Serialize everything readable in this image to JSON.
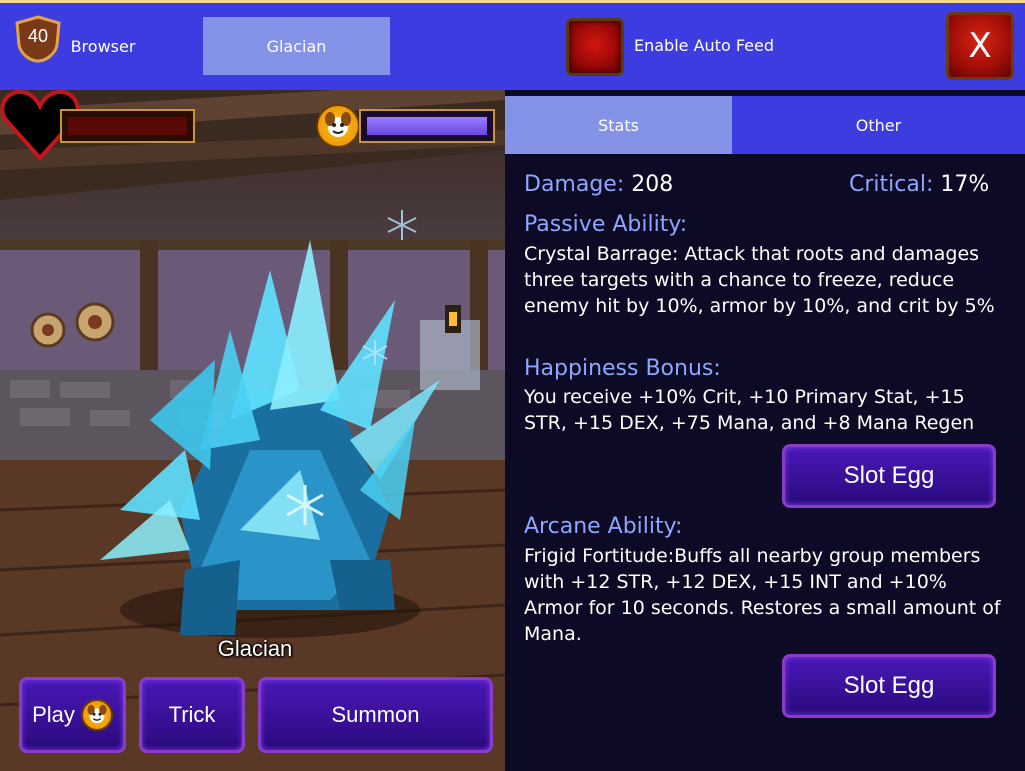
{
  "tabs": {
    "browser": "Browser",
    "pet": "Glacian"
  },
  "auto_feed": {
    "label": "Enable Auto Feed"
  },
  "close": {
    "label": "X"
  },
  "pet": {
    "level": "40",
    "name": "Glacian",
    "xp_fill": 0,
    "happiness_fill": 1.0
  },
  "actions": {
    "play": "Play",
    "trick": "Trick",
    "summon": "Summon"
  },
  "subtabs": {
    "stats": "Stats",
    "other": "Other"
  },
  "stats": {
    "damage_label": "Damage:",
    "damage_value": "208",
    "critical_label": "Critical:",
    "critical_value": "17%"
  },
  "passive": {
    "title": "Passive Ability:",
    "text": "Crystal Barrage: Attack that roots and damages three targets with a chance to freeze, reduce enemy hit by 10%, armor by 10%, and crit by 5%"
  },
  "happiness": {
    "title": "Happiness Bonus:",
    "text": "You receive +10% Crit, +10 Primary Stat, +15 STR, +15 DEX, +75 Mana, and +8 Mana Regen",
    "slot_label": "Slot Egg"
  },
  "arcane": {
    "title": "Arcane Ability:",
    "text": "Frigid Fortitude:Buffs all nearby group members with +12 STR, +12 DEX, +15 INT and +10% Armor for 10 seconds. Restores a small amount of Mana.",
    "slot_label": "Slot Egg"
  },
  "colors": {
    "topbar": "#3d3ce0",
    "tab_active": "#8492e8",
    "stat_label": "#8ea6ff",
    "button": "#3a12a0"
  }
}
